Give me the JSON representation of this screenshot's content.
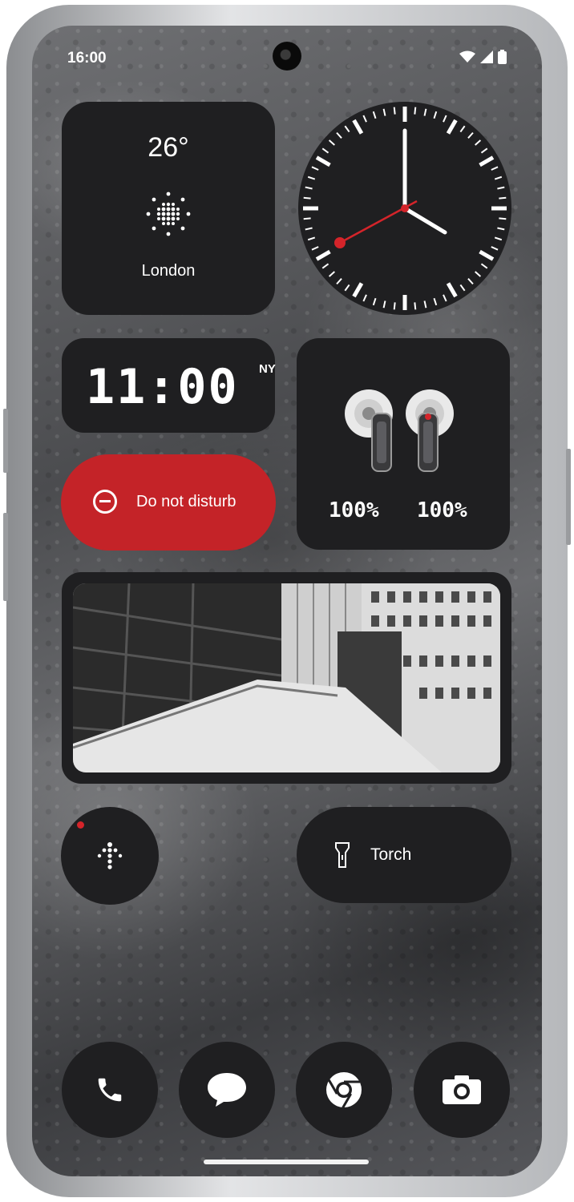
{
  "status_bar": {
    "time": "16:00"
  },
  "weather": {
    "temperature": "26°",
    "city": "London"
  },
  "world_clock": {
    "time": "11:00",
    "zone": "NY"
  },
  "earbuds": {
    "left_battery": "100%",
    "right_battery": "100%"
  },
  "dnd": {
    "label": "Do not disturb",
    "color": "#c42328"
  },
  "torch": {
    "label": "Torch"
  },
  "colors": {
    "widget_bg": "#1f1f21",
    "accent_red": "#d4242a"
  },
  "icons": [
    "sun-icon",
    "minus-circle-icon",
    "compass-icon",
    "torch-icon",
    "phone-icon",
    "messages-icon",
    "chrome-icon",
    "camera-icon"
  ]
}
